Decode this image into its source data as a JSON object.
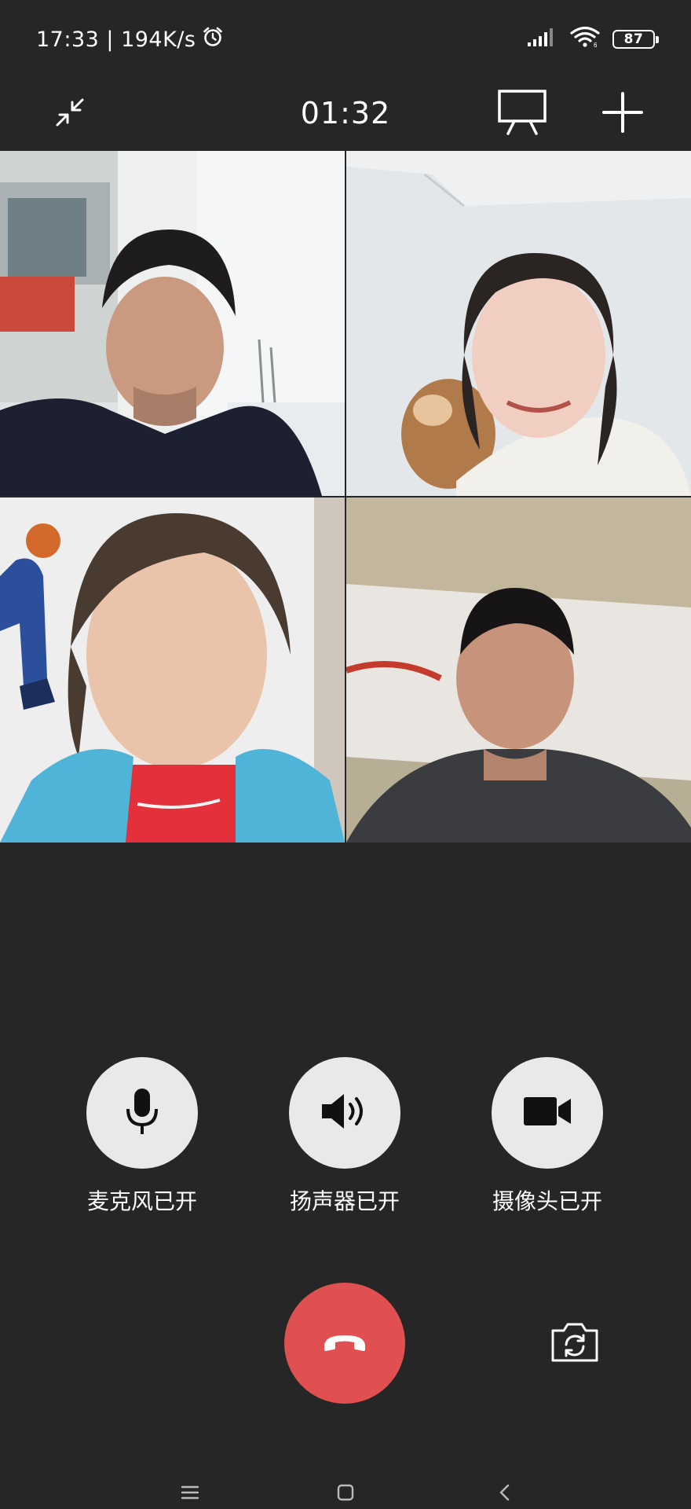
{
  "status_bar": {
    "time_speed": "17:33 | 194K/s",
    "battery": "87"
  },
  "header": {
    "timer": "01:32"
  },
  "participants": [
    {
      "icon": "participant-1-video"
    },
    {
      "icon": "participant-2-video"
    },
    {
      "icon": "participant-3-video"
    },
    {
      "icon": "participant-4-video"
    }
  ],
  "controls": {
    "mic_label": "麦克风已开",
    "speaker_label": "扬声器已开",
    "camera_label": "摄像头已开"
  },
  "colors": {
    "background": "#262626",
    "end_call": "#e05050",
    "control_bg": "#e9e9e9"
  }
}
